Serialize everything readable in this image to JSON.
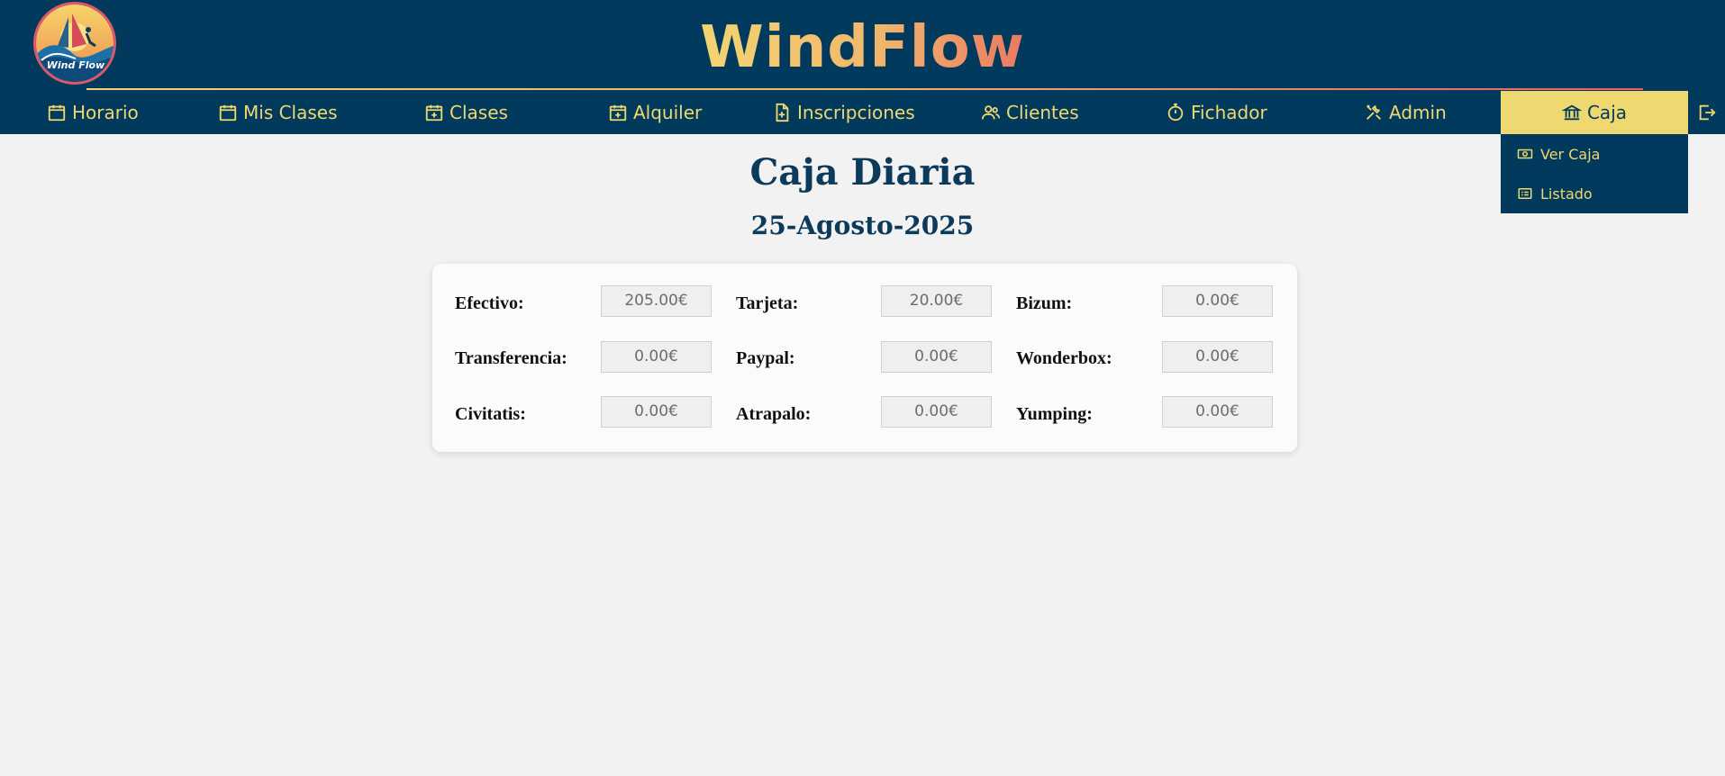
{
  "brand": "WindFlow",
  "logo_text": "Wind Flow",
  "nav": {
    "items": [
      {
        "label": "Horario",
        "icon": "calendar-icon"
      },
      {
        "label": "Mis Clases",
        "icon": "calendar-icon"
      },
      {
        "label": "Clases",
        "icon": "calendar-plus-icon"
      },
      {
        "label": "Alquiler",
        "icon": "calendar-plus-icon"
      },
      {
        "label": "Inscripciones",
        "icon": "file-plus-icon"
      },
      {
        "label": "Clientes",
        "icon": "users-icon"
      },
      {
        "label": "Fichador",
        "icon": "stopwatch-icon"
      },
      {
        "label": "Admin",
        "icon": "tools-icon"
      },
      {
        "label": "Caja",
        "icon": "bank-icon",
        "active": true
      }
    ],
    "logout_icon": "logout-icon"
  },
  "dropdown": {
    "items": [
      {
        "label": "Ver Caja",
        "icon": "cash-icon"
      },
      {
        "label": "Listado",
        "icon": "list-icon"
      }
    ]
  },
  "page": {
    "title": "Caja Diaria",
    "date": "25-Agosto-2025"
  },
  "totals": {
    "efectivo": {
      "label": "Efectivo:",
      "value": "205.00€"
    },
    "tarjeta": {
      "label": "Tarjeta:",
      "value": "20.00€"
    },
    "bizum": {
      "label": "Bizum:",
      "value": "0.00€"
    },
    "transferencia": {
      "label": "Transferencia:",
      "value": "0.00€"
    },
    "paypal": {
      "label": "Paypal:",
      "value": "0.00€"
    },
    "wonderbox": {
      "label": "Wonderbox:",
      "value": "0.00€"
    },
    "civitatis": {
      "label": "Civitatis:",
      "value": "0.00€"
    },
    "atrapalo": {
      "label": "Atrapalo:",
      "value": "0.00€"
    },
    "yumping": {
      "label": "Yumping:",
      "value": "0.00€"
    }
  },
  "colors": {
    "header_bg": "#013a5c",
    "accent_yellow": "#efd86f",
    "title_blue": "#0b3a5b"
  }
}
